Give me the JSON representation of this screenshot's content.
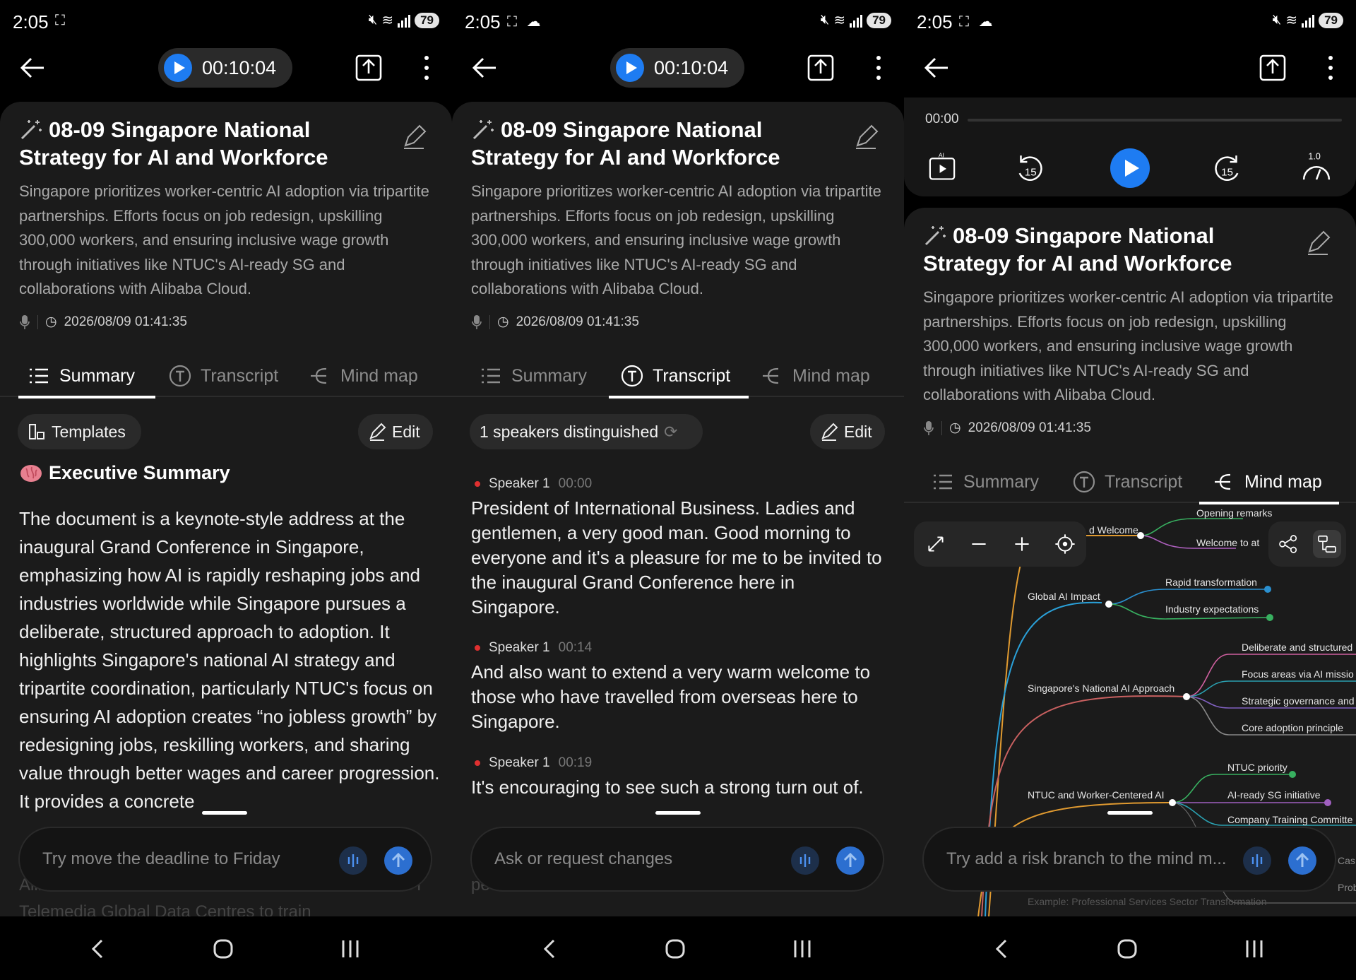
{
  "status": {
    "time": "2:05",
    "battery": "79"
  },
  "player": {
    "elapsed": "00:10:04",
    "position": "00:00",
    "speed": "1.0",
    "skip_back": "15",
    "skip_fwd": "15"
  },
  "note": {
    "title": "08-09 Singapore National Strategy for AI and Workforce",
    "description": "Singapore prioritizes worker-centric AI adoption via tripartite partnerships. Efforts focus on job redesign, upskilling 300,000 workers, and ensuring inclusive wage growth through initiatives like NTUC's AI-ready SG and collaborations with Alibaba Cloud.",
    "datetime": "2026/08/09 01:41:35"
  },
  "tabs": {
    "summary": "Summary",
    "transcript": "Transcript",
    "mindmap": "Mind map"
  },
  "summary": {
    "templates": "Templates",
    "edit": "Edit",
    "heading": "Executive Summary",
    "body": "The document is a keynote-style address at the inaugural Grand Conference in Singapore, emphasizing how AI is rapidly reshaping jobs and industries worldwide while Singapore pursues a deliberate, structured approach to adoption. It highlights Singapore's national AI strategy and tripartite coordination, particularly NTUC's focus on ensuring AI adoption creates “no jobless growth” by redesigning jobs, reskilling workers, and sharing value through better wages and career progression. It provides a concrete",
    "faded": "Alibaba Cloud and NTUC LHB will collaborate with ST Telemedia Global Data Centres to train",
    "ask_placeholder": "Try move the deadline to Friday"
  },
  "transcript": {
    "speakers": "1 speakers distinguished",
    "edit": "Edit",
    "segments": [
      {
        "speaker": "Speaker 1",
        "time": "00:00",
        "text": "President of International Business. Ladies and gentlemen, a very good man. Good morning to everyone and it's a pleasure for me to be invited to the inaugural Grand Conference here in Singapore."
      },
      {
        "speaker": "Speaker 1",
        "time": "00:14",
        "text": "And also want to extend a very warm welcome to those who have travelled from overseas here to Singapore."
      },
      {
        "speaker": "Speaker 1",
        "time": "00:19",
        "text": "It's encouraging to see such a strong turn out of."
      }
    ],
    "faded": "peo",
    "ask_placeholder": "Ask or request changes"
  },
  "mindmap": {
    "ask_placeholder": "Try add a risk branch to the mind m...",
    "nodes": {
      "welcome": "d Welcome",
      "opening": "Opening remarks",
      "welcome_to": "Welcome to at",
      "global": "Global AI Impact",
      "rapid": "Rapid transformation",
      "industry": "Industry expectations",
      "sg": "Singapore's National AI Approach",
      "deliberate": "Deliberate and structured",
      "focus": "Focus areas via AI missio",
      "strategic": "Strategic governance and",
      "core": "Core adoption principle",
      "ntuc": "NTUC and Worker-Centered AI",
      "ntuc_priority": "NTUC priority",
      "aiready": "AI-ready SG initiative",
      "company": "Company Training Committe",
      "cas": "Cas",
      "prob": "Prob",
      "example": "Example: Professional Services Sector Transformation"
    }
  },
  "colors": {
    "accent": "#1e7cf2",
    "record_dot": "#e03030"
  }
}
